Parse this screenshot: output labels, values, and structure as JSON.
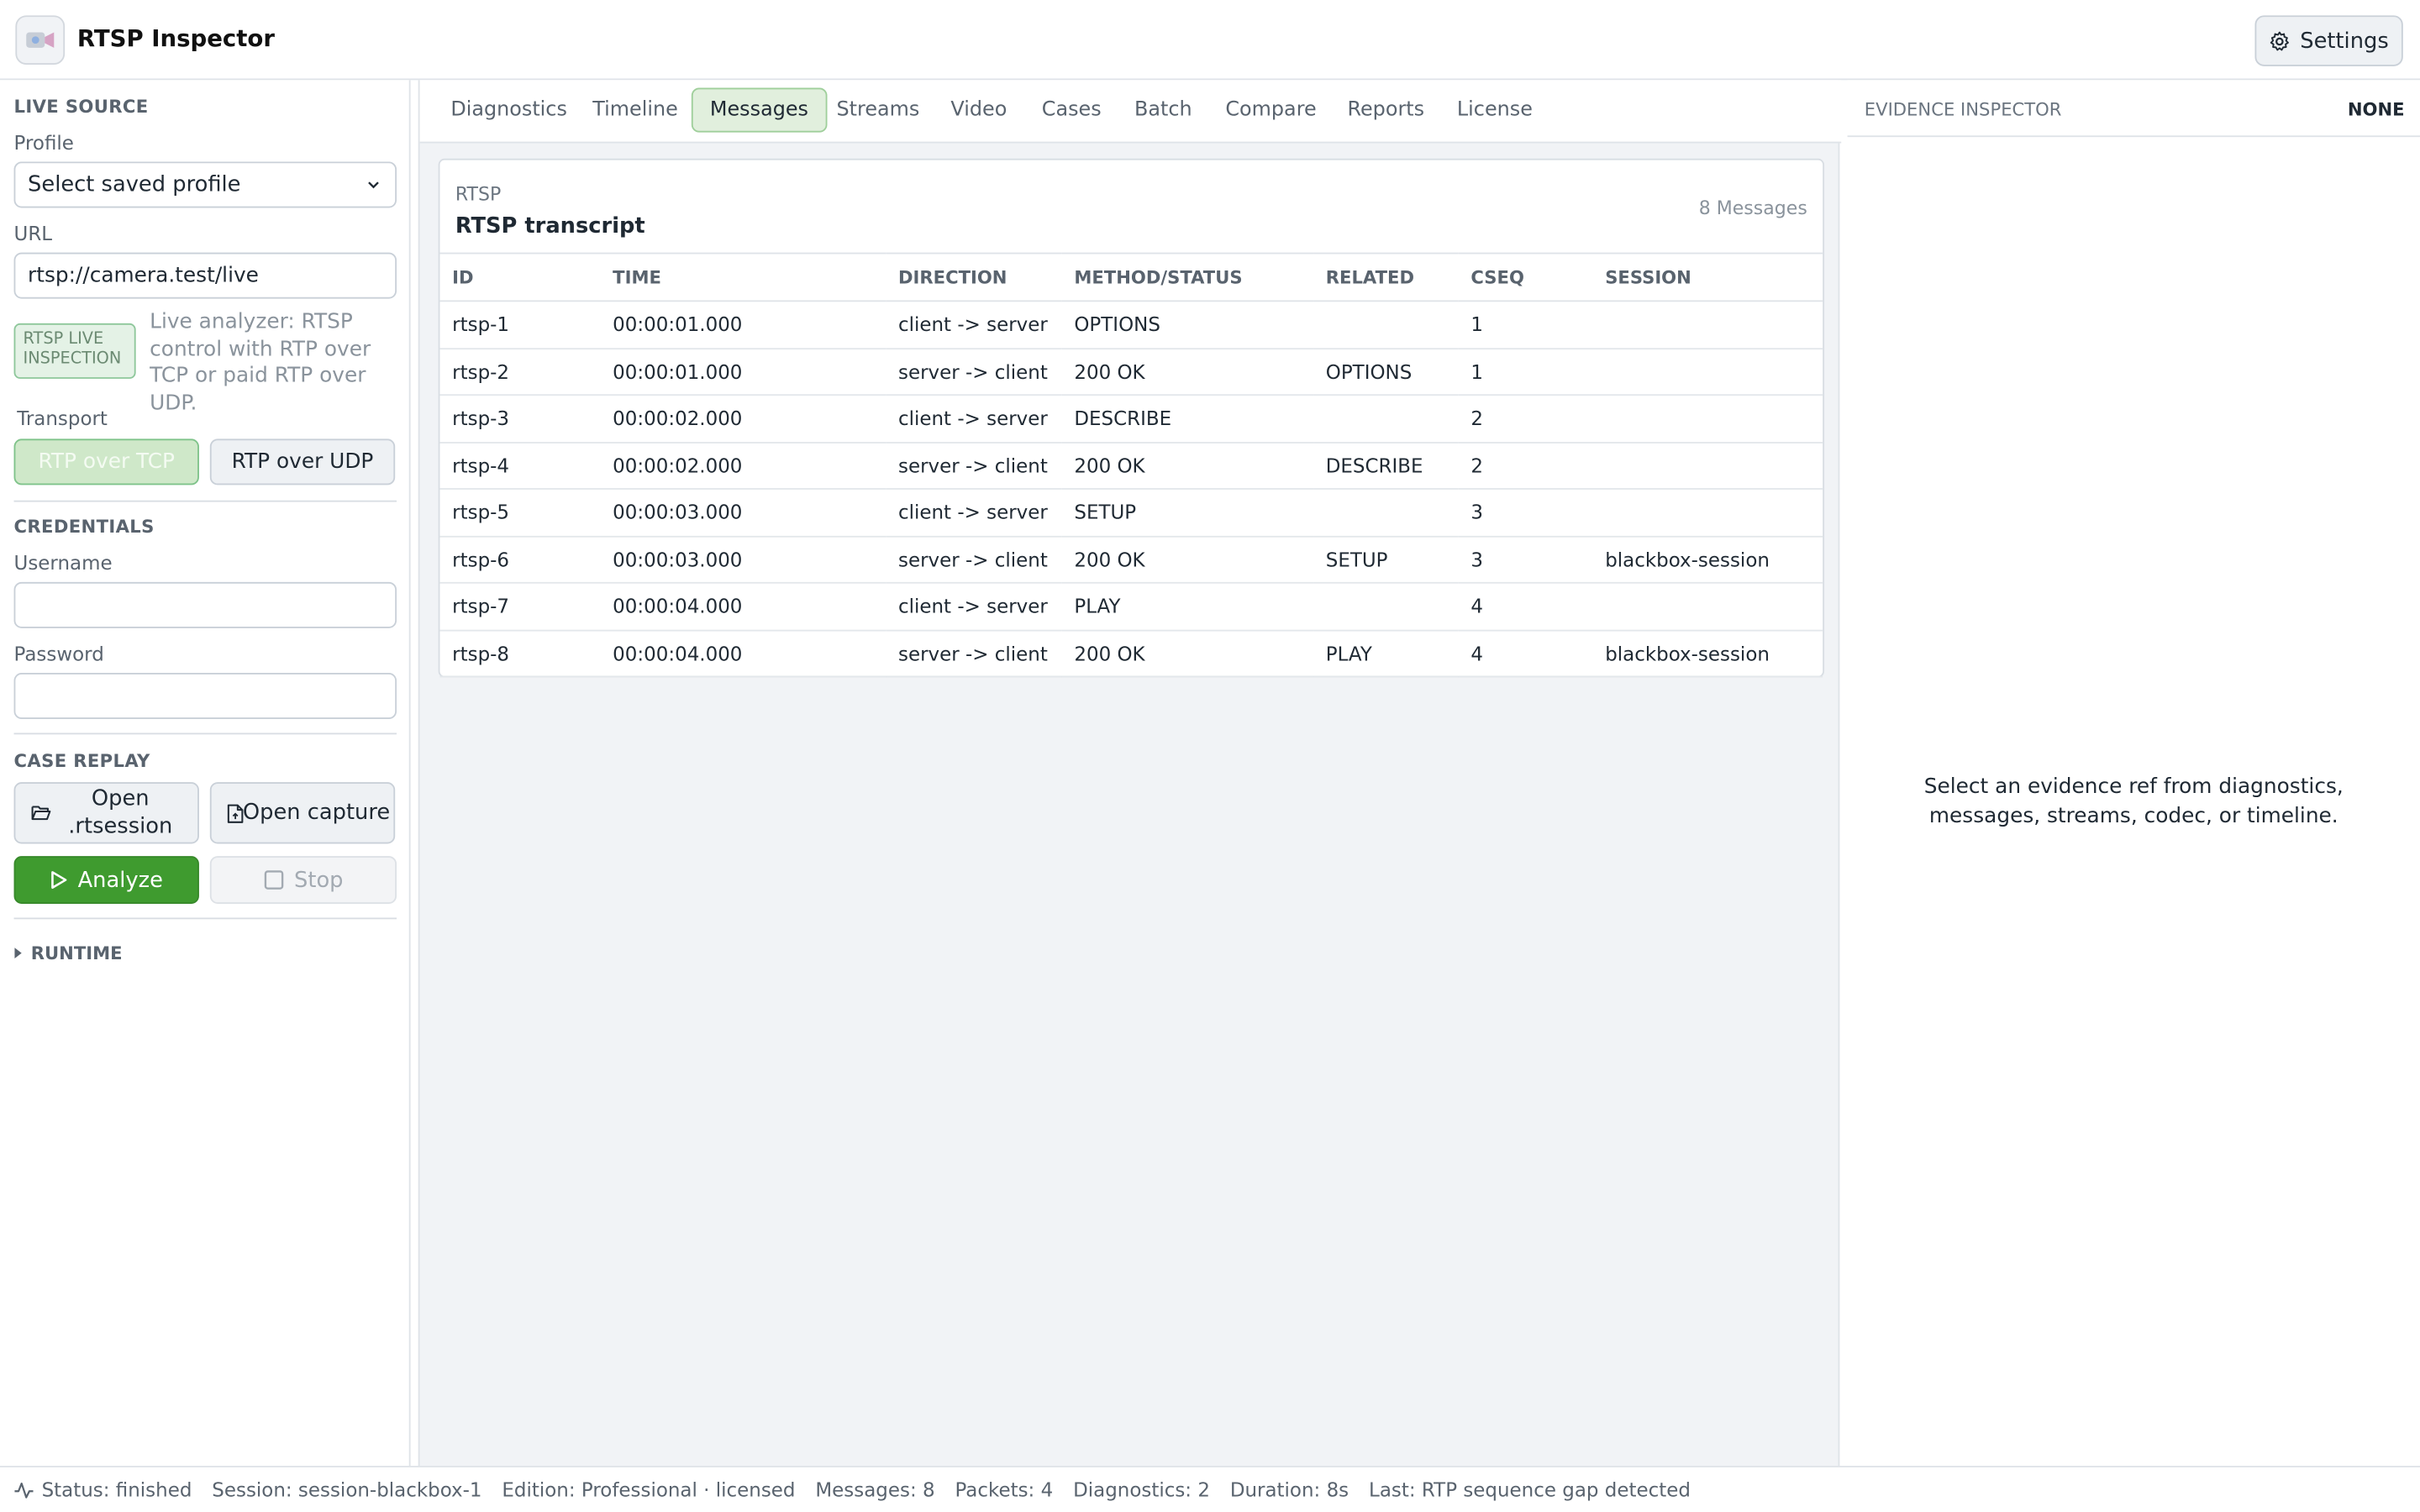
{
  "header": {
    "app_title": "RTSP Inspector",
    "settings_label": "Settings"
  },
  "sidebar": {
    "live_source_title": "LIVE SOURCE",
    "profile_label": "Profile",
    "profile_selected": "Select saved profile",
    "url_label": "URL",
    "url_value": "rtsp://camera.test/live",
    "live_badge": "RTSP LIVE INSPECTION",
    "live_description": "Live analyzer: RTSP control with RTP over TCP or paid RTP over UDP.",
    "transport_label": "Transport",
    "transport_tcp": "RTP over TCP",
    "transport_udp": "RTP over UDP",
    "credentials_title": "CREDENTIALS",
    "username_label": "Username",
    "username_value": "",
    "password_label": "Password",
    "password_value": "",
    "case_replay_title": "CASE REPLAY",
    "open_session_label": "Open .rtsession",
    "open_capture_label": "Open capture",
    "analyze_label": "Analyze",
    "stop_label": "Stop",
    "runtime_label": "RUNTIME"
  },
  "tabs": [
    {
      "label": "Diagnostics"
    },
    {
      "label": "Timeline"
    },
    {
      "label": "Messages"
    },
    {
      "label": "Streams"
    },
    {
      "label": "Video"
    },
    {
      "label": "Cases"
    },
    {
      "label": "Batch"
    },
    {
      "label": "Compare"
    },
    {
      "label": "Reports"
    },
    {
      "label": "License"
    }
  ],
  "active_tab": "Messages",
  "transcript": {
    "kicker": "RTSP",
    "title": "RTSP transcript",
    "count": "8 Messages",
    "columns": [
      "ID",
      "TIME",
      "DIRECTION",
      "METHOD/STATUS",
      "RELATED",
      "CSEQ",
      "SESSION"
    ],
    "rows": [
      [
        "rtsp-1",
        "00:00:01.000",
        "client -> server",
        "OPTIONS",
        "",
        "1",
        ""
      ],
      [
        "rtsp-2",
        "00:00:01.000",
        "server -> client",
        "200 OK",
        "OPTIONS",
        "1",
        ""
      ],
      [
        "rtsp-3",
        "00:00:02.000",
        "client -> server",
        "DESCRIBE",
        "",
        "2",
        ""
      ],
      [
        "rtsp-4",
        "00:00:02.000",
        "server -> client",
        "200 OK",
        "DESCRIBE",
        "2",
        ""
      ],
      [
        "rtsp-5",
        "00:00:03.000",
        "client -> server",
        "SETUP",
        "",
        "3",
        ""
      ],
      [
        "rtsp-6",
        "00:00:03.000",
        "server -> client",
        "200 OK",
        "SETUP",
        "3",
        "blackbox-session"
      ],
      [
        "rtsp-7",
        "00:00:04.000",
        "client -> server",
        "PLAY",
        "",
        "4",
        ""
      ],
      [
        "rtsp-8",
        "00:00:04.000",
        "server -> client",
        "200 OK",
        "PLAY",
        "4",
        "blackbox-session"
      ]
    ]
  },
  "inspector": {
    "title": "EVIDENCE INSPECTOR",
    "selection": "NONE",
    "empty_text": "Select an evidence ref from diagnostics, messages, streams, codec, or timeline."
  },
  "statusbar": {
    "status": "Status: finished",
    "session": "Session: session-blackbox-1",
    "edition": "Edition: Professional · licensed",
    "messages": "Messages: 8",
    "packets": "Packets: 4",
    "diagnostics": "Diagnostics: 2",
    "duration": "Duration: 8s",
    "last": "Last: RTP sequence gap detected"
  },
  "colors": {
    "accent_green": "#3f9b2f",
    "active_tab_bg": "#e1efdd",
    "tcp_selected_bg": "#cfe8c9"
  }
}
